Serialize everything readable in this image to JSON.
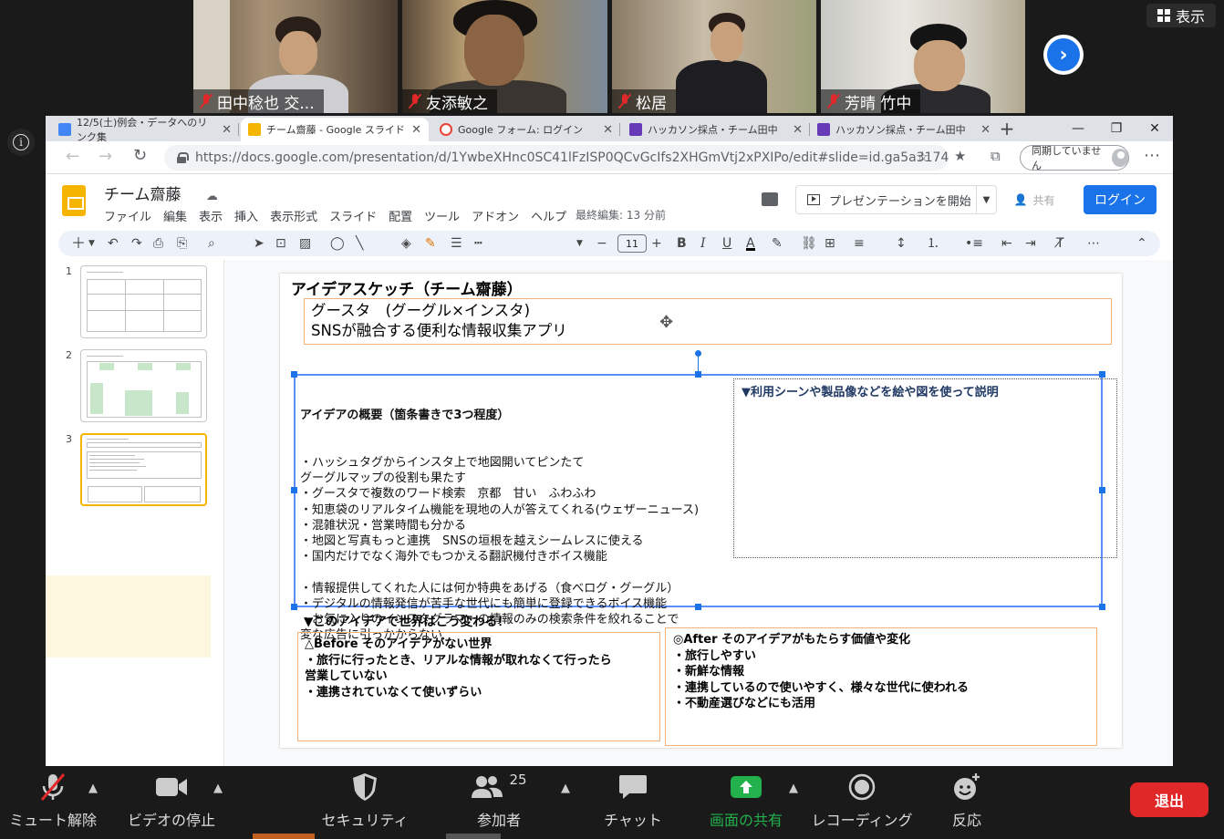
{
  "participants": [
    {
      "name": "田中稔也 交..."
    },
    {
      "name": "友添敏之"
    },
    {
      "name": "松居"
    },
    {
      "name": "芳晴 竹中"
    }
  ],
  "view_button": "表示",
  "browser": {
    "tabs": [
      {
        "label": "12/5(土)例会・データへのリンク集",
        "color": "#4285f4"
      },
      {
        "label": "チーム齋藤 - Google スライド",
        "color": "#f4b400"
      },
      {
        "label": "Google フォーム: ログイン",
        "color": "#ea4335"
      },
      {
        "label": "ハッカソン採点・チーム田中",
        "color": "#673ab7"
      },
      {
        "label": "ハッカソン採点・チーム田中",
        "color": "#673ab7"
      }
    ],
    "url": "https://docs.google.com/presentation/d/1YwbeXHnc0SC41lFzISP0QCvGcIfs2XHGmVtj2xPXIPo/edit#slide=id.ga5a3174...",
    "sync_label": "同期していません"
  },
  "slides_app": {
    "doc_title": "チーム齋藤",
    "menu": [
      "ファイル",
      "編集",
      "表示",
      "挿入",
      "表示形式",
      "スライド",
      "配置",
      "ツール",
      "アドオン",
      "ヘルプ"
    ],
    "last_edit": "最終編集: 13 分前",
    "present_label": "プレゼンテーションを開始",
    "share_label": "共有",
    "login_label": "ログイン",
    "font_size": "11",
    "slide_numbers": [
      "1",
      "2",
      "3"
    ]
  },
  "slide": {
    "title": "アイデアスケッチ（チーム齋藤）",
    "concept_line1": "グースタ　(グーグル×インスタ)",
    "concept_line2": "SNSが融合する便利な情報収集アプリ",
    "overview_heading": "アイデアの概要（箇条書きで3つ程度）",
    "overview_body": "・ハッシュタグからインスタ上で地図開いてピンたて\nグーグルマップの役割も果たす\n・グースタで複数のワード検索　京都　甘い　ふわふわ\n・知恵袋のリアルタイム機能を現地の人が答えてくれる(ウェザーニュース)\n・混雑状況・営業時間も分かる\n・地図と写真もっと連携　SNSの垣根を越えシームレスに使える\n・国内だけでなく海外でもつかえる翻訳機付きボイス機能\n\n・情報提供してくれた人には何か特典をあげる（食べログ・グーグル）\n・デジタルの情報発信が苦手な世代にも簡単に登録できるボイス機能\n・お気に入りのインスタグラマーの情報のみの検索条件を絞れることで\n変な広告に引っかからない",
    "scene_label": "▼利用シーンや製品像などを絵や図を使って説明",
    "change_title": "▼このアイデアで世界はこう変わる！",
    "before_text": "△Before そのアイデアがない世界\n・旅行に行ったとき、リアルな情報が取れなくて行ったら\n営業していない\n・連携されていなくて使いずらい",
    "after_text": "◎After そのアイデアがもたらす価値や変化\n・旅行しやすい\n・新鮮な情報\n・連携しているので使いやすく、様々な世代に使われる\n・不動産選びなどにも活用"
  },
  "zoom_controls": {
    "unmute": "ミュート解除",
    "stop_video": "ビデオの停止",
    "security": "セキュリティ",
    "participants": "参加者",
    "participant_count": "25",
    "chat": "チャット",
    "share_screen": "画面の共有",
    "record": "レコーディング",
    "reactions": "反応",
    "leave": "退出"
  },
  "colors": {
    "zoom_bg": "#1a1a1a",
    "share_green": "#23b14d",
    "leave_red": "#e02828",
    "slides_blue": "#1a73e8",
    "slides_yellow": "#f4b400",
    "box_orange": "#f2b27c"
  }
}
